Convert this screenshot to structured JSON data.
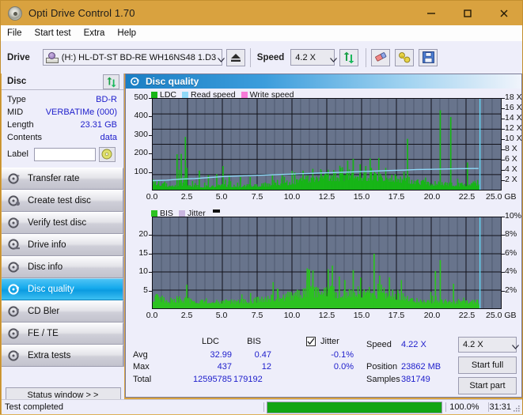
{
  "window": {
    "title": "Opti Drive Control 1.70",
    "app_icon": "disc-icon",
    "minimize": "minimize-icon",
    "maximize": "maximize-icon",
    "close": "close-icon",
    "titlebar_color": "#d9a23f"
  },
  "menu": {
    "items": [
      "File",
      "Start test",
      "Extra",
      "Help"
    ]
  },
  "toolbar": {
    "drive_label": "Drive",
    "drive_value": "(H:)  HL-DT-ST BD-RE  WH16NS48 1.D3",
    "eject_icon": "eject-icon",
    "speed_label": "Speed",
    "speed_value": "4.2 X",
    "refresh_icon": "refresh-icon",
    "erase_icon": "eraser-icon",
    "tools_icon": "wrench-icon",
    "save_icon": "save-floppy-icon"
  },
  "disc_panel": {
    "title": "Disc",
    "refresh_icon": "refresh-icon",
    "rows": [
      {
        "key": "Type",
        "value": "BD-R"
      },
      {
        "key": "MID",
        "value": "VERBATIMe (000)"
      },
      {
        "key": "Length",
        "value": "23.31 GB"
      },
      {
        "key": "Contents",
        "value": "data"
      }
    ],
    "label_key": "Label",
    "label_value": "",
    "label_placeholder": "",
    "label_button_icon": "cd-icon"
  },
  "nav": {
    "items": [
      {
        "label": "Transfer rate",
        "icon": "disc-transfer-icon",
        "selected": false
      },
      {
        "label": "Create test disc",
        "icon": "disc-create-icon",
        "selected": false
      },
      {
        "label": "Verify test disc",
        "icon": "disc-verify-icon",
        "selected": false
      },
      {
        "label": "Drive info",
        "icon": "disc-drive-icon",
        "selected": false
      },
      {
        "label": "Disc info",
        "icon": "disc-info-icon",
        "selected": false
      },
      {
        "label": "Disc quality",
        "icon": "disc-quality-icon",
        "selected": true
      },
      {
        "label": "CD Bler",
        "icon": "disc-bler-icon",
        "selected": false
      },
      {
        "label": "FE / TE",
        "icon": "disc-fete-icon",
        "selected": false
      },
      {
        "label": "Extra tests",
        "icon": "disc-extra-icon",
        "selected": false
      }
    ],
    "status_window_label": "Status window > >"
  },
  "main": {
    "title": "Disc quality",
    "title_icon": "disc-quality-icon"
  },
  "stats": {
    "col_ldc": "LDC",
    "col_bis": "BIS",
    "jitter_label": "Jitter",
    "jitter_checked": true,
    "rows": [
      {
        "name": "Avg",
        "ldc": "32.99",
        "bis": "0.47",
        "jitter": "-0.1%"
      },
      {
        "name": "Max",
        "ldc": "437",
        "bis": "12",
        "jitter": "0.0%"
      },
      {
        "name": "Total",
        "ldc": "12595785",
        "bis": "179192",
        "jitter": ""
      }
    ],
    "speed_label": "Speed",
    "speed_value": "4.22 X",
    "position_label": "Position",
    "position_value": "23862 MB",
    "samples_label": "Samples",
    "samples_value": "381749",
    "speed_select_value": "4.2 X",
    "start_full_label": "Start full",
    "start_part_label": "Start part"
  },
  "statusbar": {
    "status_text": "Test completed",
    "progress_percent_label": "100.0%",
    "progress_percent": 100,
    "elapsed": "31:31"
  },
  "colors": {
    "ldc_green": "#17b517",
    "read_speed": "#8fd8f7",
    "write_speed": "#f77ad8",
    "bis_green": "#2cc220",
    "jitter_violet": "#c9b6e0",
    "plot_bg": "#68748c",
    "accent_blue": "#2020cc"
  },
  "chart_data": [
    {
      "type": "area",
      "title": "Disc quality - LDC / Read speed",
      "xlabel": "GB",
      "ylabel": "LDC",
      "xlim": [
        0,
        25
      ],
      "ylim": [
        0,
        500
      ],
      "y2lim": [
        0,
        18
      ],
      "y2label": "X",
      "grid": true,
      "legend_position": "top-left",
      "legend": [
        "LDC",
        "Read speed",
        "Write speed"
      ],
      "xticks": [
        "0.0",
        "2.5",
        "5.0",
        "7.5",
        "10.0",
        "12.5",
        "15.0",
        "17.5",
        "20.0",
        "22.5",
        "25.0 GB"
      ],
      "yticks": [
        "500",
        "400",
        "300",
        "200",
        "100"
      ],
      "y2ticks": [
        "18 X",
        "16 X",
        "14 X",
        "12 X",
        "10 X",
        "8 X",
        "6 X",
        "4 X",
        "2 X"
      ],
      "data_end_gb": 23.5,
      "series": [
        {
          "name": "LDC",
          "color": "#17b517",
          "x": [
            0.0,
            0.3,
            0.6,
            0.9,
            1.2,
            1.5,
            1.8,
            2.1,
            2.4,
            2.7,
            3.0,
            3.4,
            3.8,
            4.2,
            4.6,
            5.0,
            5.4,
            5.8,
            6.2,
            6.6,
            7.0,
            7.4,
            7.8,
            8.2,
            8.6,
            9.0,
            9.4,
            9.8,
            10.2,
            10.6,
            11.0,
            11.4,
            11.8,
            12.2,
            12.6,
            13.0,
            13.4,
            13.8,
            14.2,
            14.6,
            15.0,
            15.4,
            15.8,
            16.2,
            16.6,
            17.0,
            17.4,
            17.8,
            18.2,
            18.6,
            19.0,
            19.4,
            19.8,
            20.2,
            20.6,
            21.0,
            21.4,
            21.8,
            22.2,
            22.6,
            23.0,
            23.4
          ],
          "values": [
            50,
            45,
            38,
            32,
            26,
            24,
            30,
            40,
            38,
            26,
            24,
            22,
            22,
            24,
            26,
            28,
            26,
            24,
            24,
            26,
            26,
            28,
            30,
            32,
            34,
            36,
            40,
            46,
            52,
            58,
            66,
            74,
            80,
            86,
            88,
            86,
            84,
            86,
            96,
            92,
            90,
            88,
            86,
            84,
            82,
            80,
            76,
            70,
            64,
            58,
            52,
            46,
            42,
            40,
            42,
            38,
            36,
            34,
            32,
            38,
            44,
            40
          ],
          "spikes": [
            {
              "x": 1.75,
              "y": 195
            },
            {
              "x": 1.9,
              "y": 110
            },
            {
              "x": 2.05,
              "y": 197
            },
            {
              "x": 2.35,
              "y": 290
            },
            {
              "x": 2.45,
              "y": 120
            },
            {
              "x": 3.35,
              "y": 105
            },
            {
              "x": 4.0,
              "y": 80
            },
            {
              "x": 4.6,
              "y": 85
            },
            {
              "x": 5.05,
              "y": 130
            },
            {
              "x": 5.5,
              "y": 80
            },
            {
              "x": 6.3,
              "y": 70
            },
            {
              "x": 7.0,
              "y": 70
            },
            {
              "x": 8.6,
              "y": 80
            },
            {
              "x": 9.3,
              "y": 80
            },
            {
              "x": 10.2,
              "y": 95
            },
            {
              "x": 10.8,
              "y": 105
            },
            {
              "x": 11.5,
              "y": 115
            },
            {
              "x": 12.1,
              "y": 105
            },
            {
              "x": 12.6,
              "y": 110
            },
            {
              "x": 13.0,
              "y": 108
            },
            {
              "x": 13.5,
              "y": 120
            },
            {
              "x": 14.0,
              "y": 160
            },
            {
              "x": 14.4,
              "y": 170
            },
            {
              "x": 14.9,
              "y": 140
            },
            {
              "x": 15.3,
              "y": 130
            },
            {
              "x": 15.7,
              "y": 120
            },
            {
              "x": 18.3,
              "y": 280
            },
            {
              "x": 20.65,
              "y": 437
            },
            {
              "x": 21.4,
              "y": 400
            },
            {
              "x": 22.6,
              "y": 150
            }
          ]
        },
        {
          "name": "Read speed",
          "color": "#8fd8f7",
          "x": [
            0.0,
            1.0,
            2.0,
            3.0,
            4.0,
            5.0,
            6.0,
            7.0,
            8.0,
            9.0,
            10.0,
            11.0,
            12.0,
            13.0,
            14.0,
            15.0,
            16.0,
            17.0,
            18.0,
            19.0,
            20.0,
            21.0,
            22.0,
            23.0,
            23.4
          ],
          "values": [
            1.8,
            1.9,
            2.1,
            2.2,
            2.4,
            2.6,
            2.7,
            2.8,
            2.9,
            3.0,
            3.1,
            3.2,
            3.3,
            3.4,
            3.5,
            3.6,
            3.7,
            3.8,
            3.9,
            4.0,
            4.05,
            4.1,
            4.15,
            4.2,
            4.2
          ]
        },
        {
          "name": "Write speed",
          "color": "#f77ad8",
          "x": [],
          "values": []
        }
      ],
      "cursor_line_gb": 23.5
    },
    {
      "type": "area",
      "title": "Disc quality - BIS / Jitter",
      "xlabel": "GB",
      "ylabel": "BIS",
      "xlim": [
        0,
        25
      ],
      "ylim": [
        0,
        20
      ],
      "y2lim": [
        0,
        10
      ],
      "y2label": "%",
      "grid": true,
      "legend_position": "top-left",
      "legend": [
        "BIS",
        "Jitter"
      ],
      "xticks": [
        "0.0",
        "2.5",
        "5.0",
        "7.5",
        "10.0",
        "12.5",
        "15.0",
        "17.5",
        "20.0",
        "22.5",
        "25.0 GB"
      ],
      "yticks": [
        "20",
        "15",
        "10",
        "5"
      ],
      "y2ticks": [
        "10%",
        "8%",
        "6%",
        "4%",
        "2%"
      ],
      "data_end_gb": 23.5,
      "series": [
        {
          "name": "BIS",
          "color": "#2cc220",
          "x": [
            0.0,
            0.4,
            0.8,
            1.2,
            1.6,
            2.0,
            2.4,
            2.8,
            3.2,
            3.6,
            4.0,
            4.4,
            4.8,
            5.2,
            5.6,
            6.0,
            6.4,
            6.8,
            7.2,
            7.6,
            8.0,
            8.4,
            8.8,
            9.2,
            9.6,
            10.0,
            10.4,
            10.8,
            11.2,
            11.6,
            12.0,
            12.4,
            12.8,
            13.2,
            13.6,
            14.0,
            14.4,
            14.8,
            15.2,
            15.6,
            16.0,
            16.4,
            16.8,
            17.2,
            17.6,
            18.0,
            18.4,
            18.8,
            19.2,
            19.6,
            20.0,
            20.4,
            20.8,
            21.2,
            21.6,
            22.0,
            22.4,
            23.0,
            23.4
          ],
          "values": [
            2.4,
            2.8,
            2.2,
            2.0,
            2.4,
            2.0,
            2.2,
            1.8,
            2.0,
            1.8,
            2.0,
            2.2,
            1.8,
            2.0,
            1.8,
            1.6,
            2.0,
            1.8,
            2.0,
            2.2,
            2.4,
            2.6,
            2.8,
            2.6,
            3.0,
            3.2,
            3.6,
            4.0,
            4.4,
            4.2,
            4.6,
            5.0,
            4.4,
            4.0,
            3.8,
            4.2,
            4.6,
            4.2,
            4.4,
            4.0,
            3.8,
            4.2,
            3.8,
            3.6,
            3.4,
            3.2,
            2.8,
            2.4,
            2.0,
            1.6,
            1.8,
            2.4,
            1.6,
            1.8,
            1.4,
            1.8,
            2.0,
            1.8,
            1.6
          ],
          "spikes": [
            {
              "x": 2.45,
              "y": 5.2
            },
            {
              "x": 9.0,
              "y": 4.2
            },
            {
              "x": 11.1,
              "y": 8.8
            },
            {
              "x": 11.5,
              "y": 6.6
            },
            {
              "x": 12.6,
              "y": 8.6
            },
            {
              "x": 12.9,
              "y": 9.4
            },
            {
              "x": 13.4,
              "y": 7.0
            },
            {
              "x": 13.8,
              "y": 6.2
            },
            {
              "x": 15.9,
              "y": 12.0
            },
            {
              "x": 14.4,
              "y": 8.4
            },
            {
              "x": 16.3,
              "y": 7.2
            },
            {
              "x": 17.0,
              "y": 6.8
            },
            {
              "x": 20.65,
              "y": 10.6
            },
            {
              "x": 20.3,
              "y": 8.2
            },
            {
              "x": 21.6,
              "y": 5.4
            }
          ]
        },
        {
          "name": "Jitter",
          "color": "#c9b6e0",
          "x": [],
          "values": []
        }
      ],
      "cursor_line_gb": 23.5
    }
  ]
}
